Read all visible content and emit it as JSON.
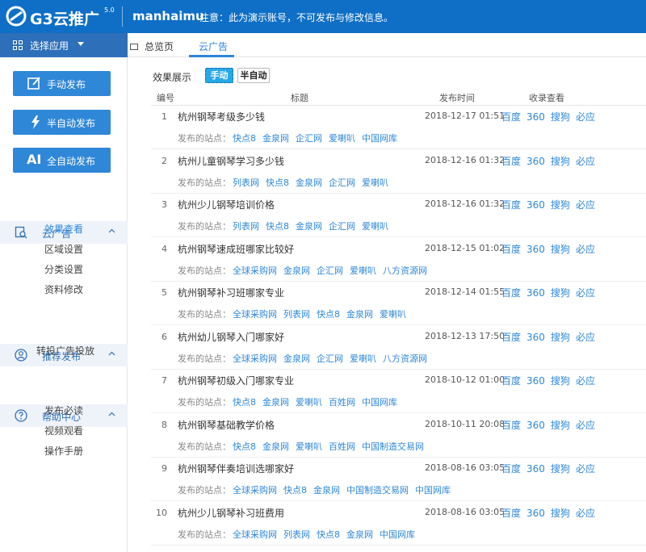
{
  "header": {
    "logo": "G3云推广",
    "logo_version": "5.0",
    "username": "manhaimu",
    "notice": "注意：此为演示账号，不可发布与修改信息。"
  },
  "sidebar": {
    "app_select": "选择应用",
    "buttons": {
      "manual": "手动发布",
      "semi": "半自动发布",
      "auto_ai": "AI",
      "auto": "全自动发布"
    },
    "menus": [
      {
        "title": "云广告",
        "items": [
          "效果查看",
          "区域设置",
          "分类设置",
          "资料修改"
        ]
      },
      {
        "title": "推荐发布",
        "items": [
          "转投广告投放"
        ]
      },
      {
        "title": "帮助中心",
        "items": [
          "发布必读",
          "视频观看",
          "操作手册"
        ]
      }
    ]
  },
  "tabs": {
    "home": "总览页",
    "cloud": "云广告"
  },
  "mode": {
    "label": "效果展示",
    "manual": "手动",
    "semi": "半自动"
  },
  "table": {
    "headers": [
      "编号",
      "标题",
      "发布时间",
      "收录查看"
    ],
    "sites_prefix": "发布的站点：",
    "engines": [
      "百度",
      "360",
      "搜狗",
      "必应"
    ],
    "rows": [
      {
        "num": "1",
        "title": "杭州钢琴考级多少钱",
        "time": "2018-12-17 01:51",
        "sites": [
          "快点8",
          "金泉网",
          "企汇网",
          "爱喇叭",
          "中国网库"
        ]
      },
      {
        "num": "2",
        "title": "杭州儿童钢琴学习多少钱",
        "time": "2018-12-16 01:32",
        "sites": [
          "列表网",
          "快点8",
          "金泉网",
          "企汇网",
          "爱喇叭"
        ]
      },
      {
        "num": "3",
        "title": "杭州少儿钢琴培训价格",
        "time": "2018-12-16 01:32",
        "sites": [
          "列表网",
          "快点8",
          "金泉网",
          "企汇网",
          "爱喇叭"
        ]
      },
      {
        "num": "4",
        "title": "杭州钢琴速成班哪家比较好",
        "time": "2018-12-15 01:02",
        "sites": [
          "全球采购网",
          "金泉网",
          "企汇网",
          "爱喇叭",
          "八方资源网"
        ]
      },
      {
        "num": "5",
        "title": "杭州钢琴补习班哪家专业",
        "time": "2018-12-14 01:55",
        "sites": [
          "全球采购网",
          "列表网",
          "快点8",
          "金泉网",
          "爱喇叭"
        ]
      },
      {
        "num": "6",
        "title": "杭州幼儿钢琴入门哪家好",
        "time": "2018-12-13 17:50",
        "sites": [
          "全球采购网",
          "金泉网",
          "企汇网",
          "爱喇叭",
          "八方资源网"
        ]
      },
      {
        "num": "7",
        "title": "杭州钢琴初级入门哪家专业",
        "time": "2018-10-12 01:00",
        "sites": [
          "快点8",
          "金泉网",
          "爱喇叭",
          "百姓网",
          "中国网库"
        ]
      },
      {
        "num": "8",
        "title": "杭州钢琴基础教学价格",
        "time": "2018-10-11 20:08",
        "sites": [
          "快点8",
          "金泉网",
          "爱喇叭",
          "百姓网",
          "中国制造交易网"
        ]
      },
      {
        "num": "9",
        "title": "杭州钢琴伴奏培训选哪家好",
        "time": "2018-08-16 03:05",
        "sites": [
          "全球采购网",
          "快点8",
          "金泉网",
          "中国制造交易网",
          "中国网库"
        ]
      },
      {
        "num": "10",
        "title": "杭州少儿钢琴补习班费用",
        "time": "2018-08-16 03:05",
        "sites": [
          "全球采购网",
          "列表网",
          "快点8",
          "金泉网",
          "中国网库"
        ]
      }
    ]
  },
  "colors": {
    "header": "#0f6fc6",
    "accent": "#2f87d8",
    "menu_bg": "#eef3f9"
  }
}
